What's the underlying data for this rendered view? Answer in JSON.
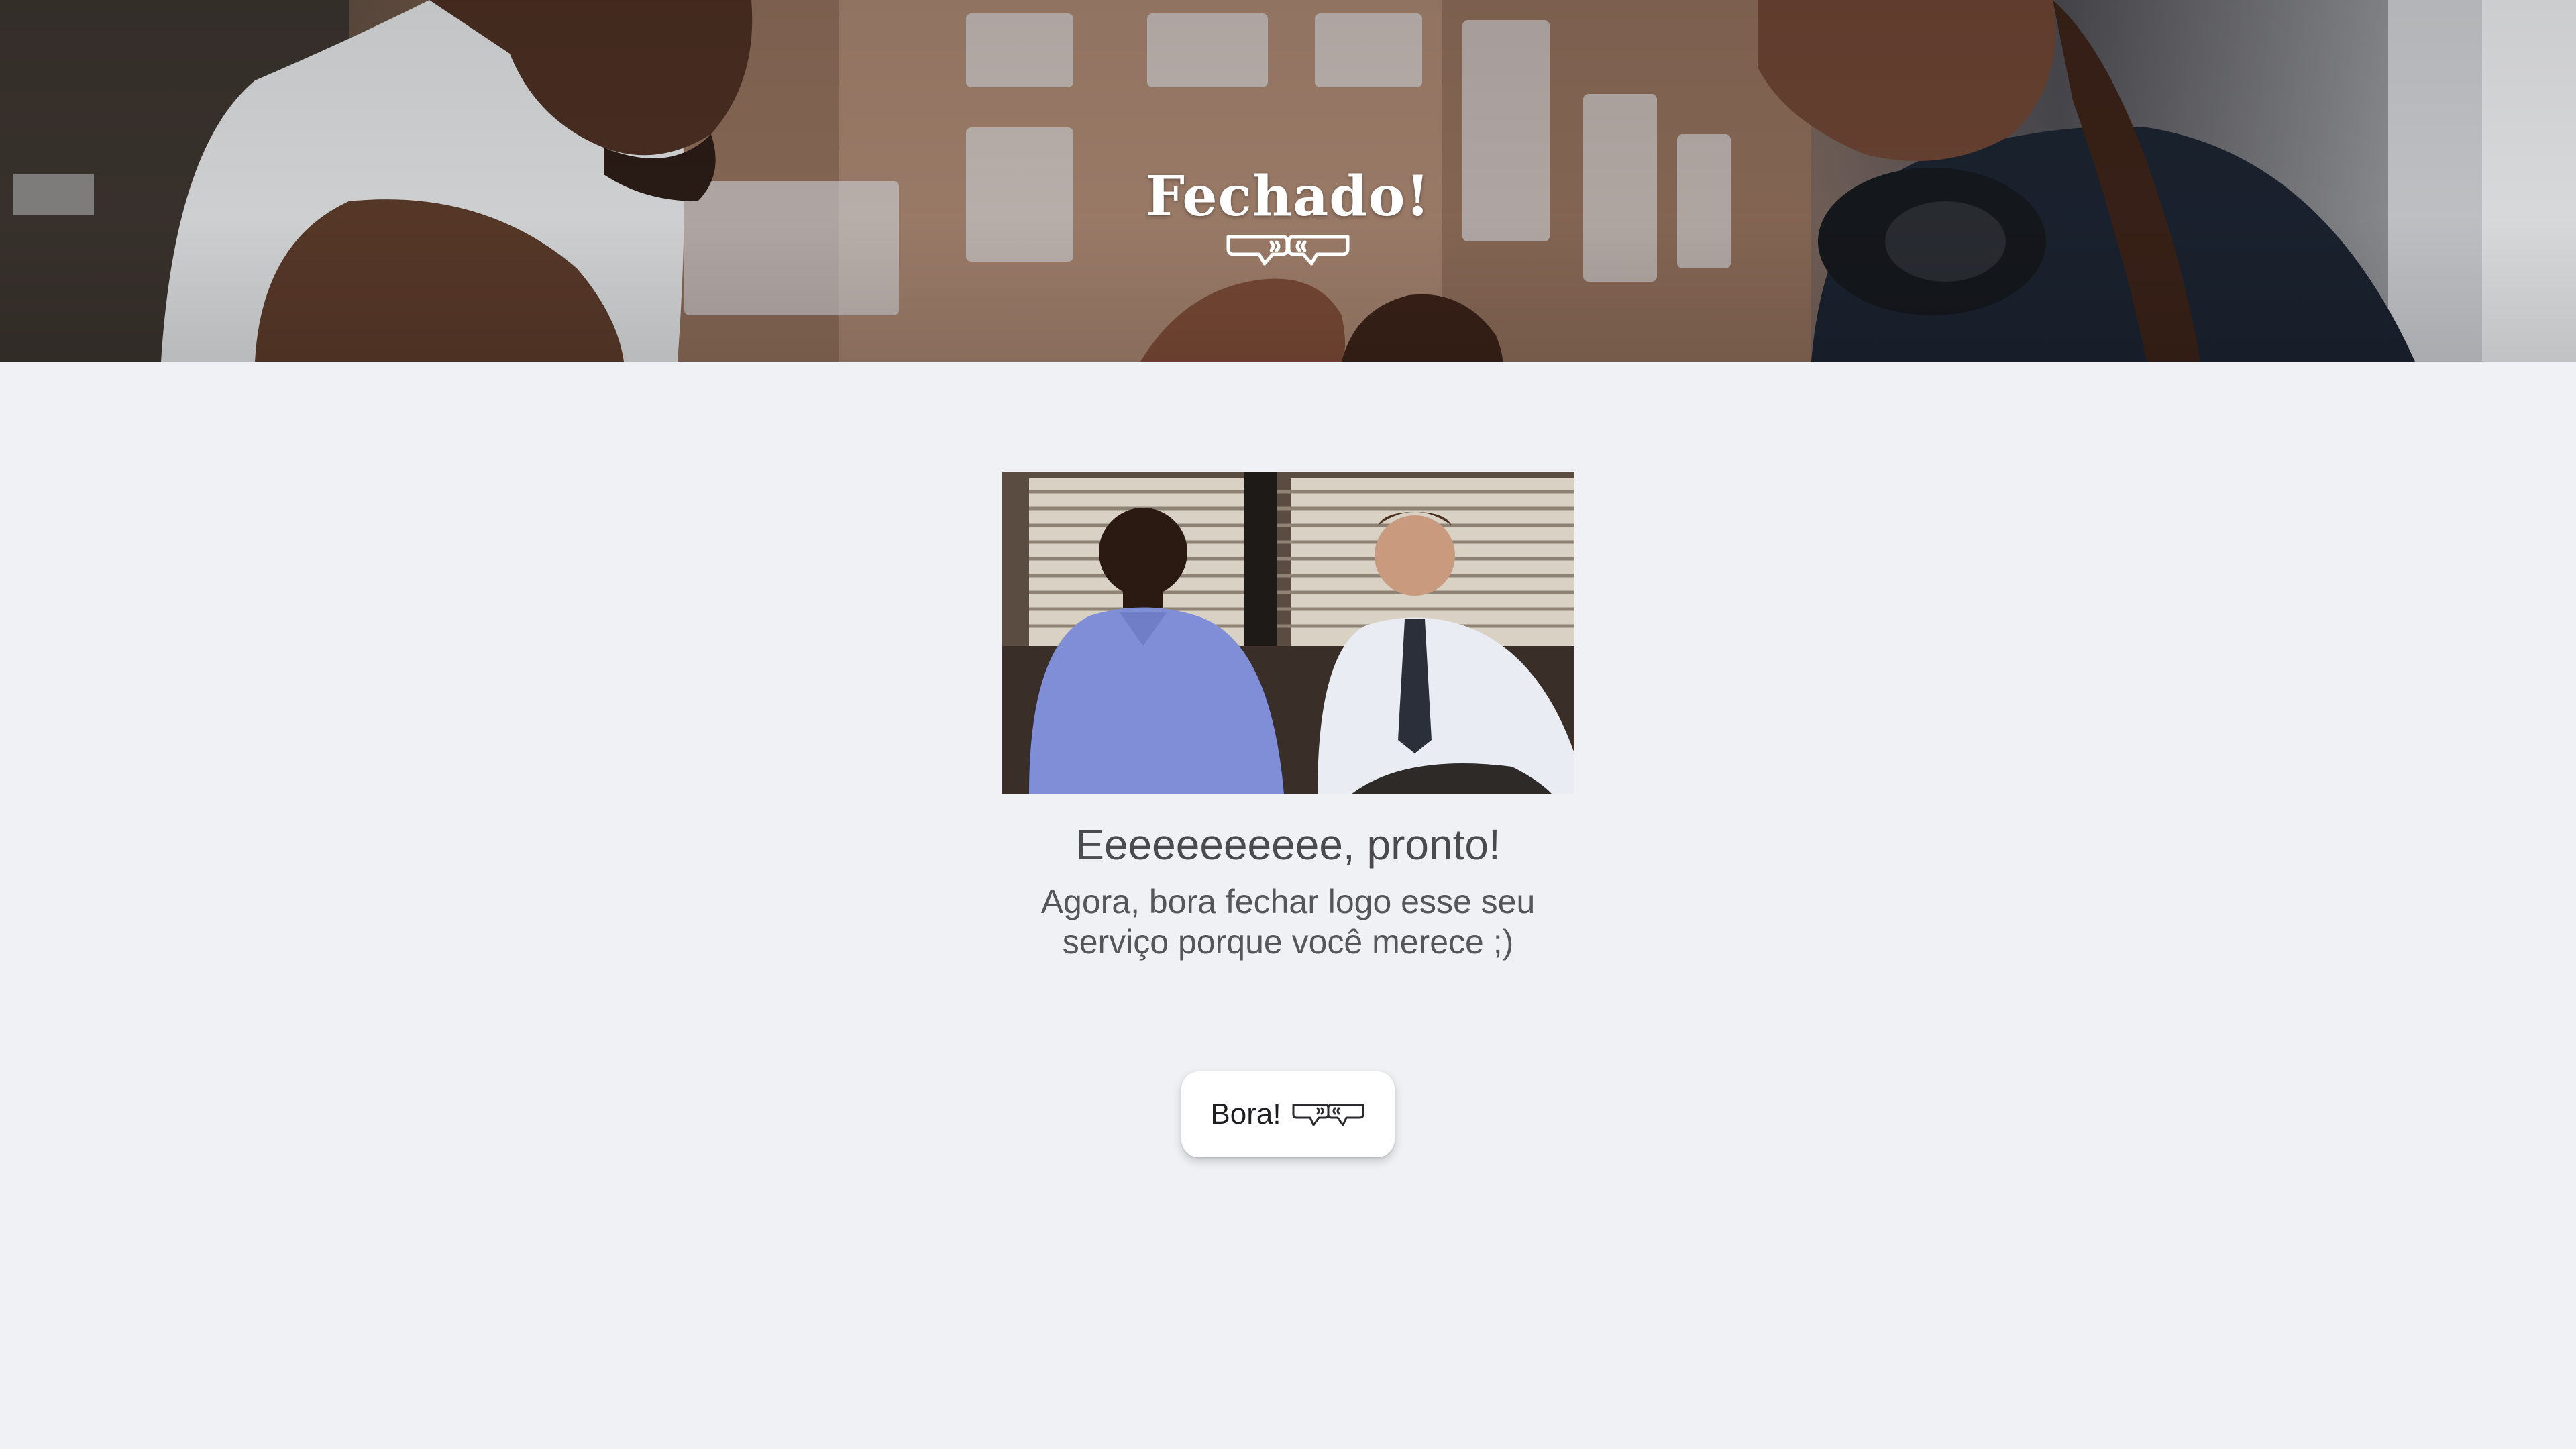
{
  "hero": {
    "logo_text": "Fechado!",
    "logo_icon": "fist-bump-icon"
  },
  "main": {
    "image_icon": "celebration-gif",
    "headline": "Eeeeeeeeeee, pronto!",
    "subtext_line1": "Agora, bora fechar logo esse seu",
    "subtext_line2": "serviço porque você merece ;)",
    "cta_label": "Bora!",
    "cta_icon": "fist-bump-icon"
  },
  "colors": {
    "background": "#f0f1f5",
    "text": "#4a4a4f",
    "button_bg": "#ffffff"
  }
}
